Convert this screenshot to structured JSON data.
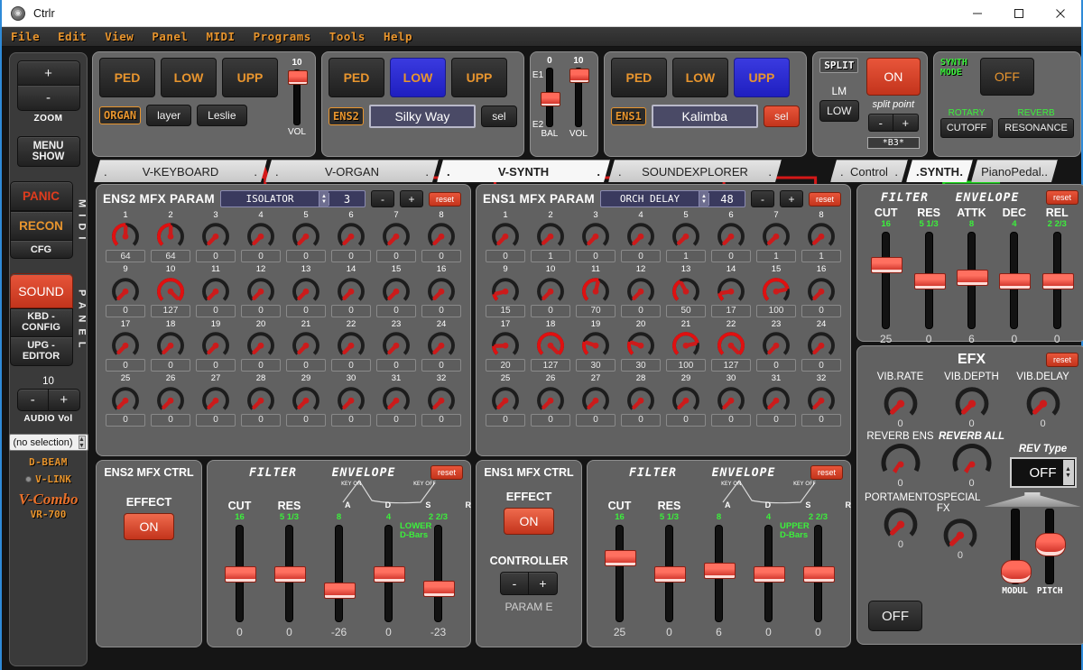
{
  "window": {
    "title": "Ctrlr",
    "minimize": "—",
    "maximize": "□",
    "close": "✕"
  },
  "menubar": {
    "items": [
      "File",
      "Edit",
      "View",
      "Panel",
      "MIDI",
      "Programs",
      "Tools",
      "Help"
    ]
  },
  "sidebar": {
    "zoom_plus": "+",
    "zoom_minus": "-",
    "zoom_label": "ZOOM",
    "menu_show_l1": "MENU",
    "menu_show_l2": "SHOW",
    "panic": "PANIC",
    "recon": "RECON",
    "cfg": "CFG",
    "midi_label": "M I D I",
    "sound": "SOUND",
    "kbd_l1": "KBD -",
    "kbd_l2": "CONFIG",
    "upg_l1": "UPG -",
    "upg_l2": "EDITOR",
    "panel_label": "P A N E L",
    "vol_value": "10",
    "vol_minus": "-",
    "vol_plus": "+",
    "vol_label": "AUDIO Vol",
    "selection": "(no selection)",
    "dbeam": "D-BEAM",
    "vlink": "V-LINK",
    "brand": "V-Combo",
    "brand_model": "VR-700"
  },
  "header": {
    "organ": {
      "parts": [
        {
          "label": "PED",
          "state": "off"
        },
        {
          "label": "LOW",
          "state": "off"
        },
        {
          "label": "UPP",
          "state": "off"
        }
      ],
      "tag": "ORGAN",
      "layer": "layer",
      "leslie": "Leslie",
      "vol_top": "10",
      "vol_label": "VOL"
    },
    "ens2": {
      "parts": [
        {
          "label": "PED",
          "state": "off"
        },
        {
          "label": "LOW",
          "state": "on"
        },
        {
          "label": "UPP",
          "state": "off"
        }
      ],
      "tag": "ENS2",
      "patch": "Silky Way",
      "sel": "sel"
    },
    "bal": {
      "bal_top": "0",
      "vol_top": "10",
      "e1": "E1",
      "e2": "E2",
      "bal_label": "BAL",
      "vol_label": "VOL"
    },
    "ens1": {
      "parts": [
        {
          "label": "PED",
          "state": "off"
        },
        {
          "label": "LOW",
          "state": "off"
        },
        {
          "label": "UPP",
          "state": "on"
        }
      ],
      "tag": "ENS1",
      "patch": "Kalimba",
      "sel": "sel"
    },
    "split": {
      "tag": "SPLIT",
      "on": "ON",
      "lm": "LM",
      "low": "LOW",
      "split_point_label": "split point",
      "minus": "-",
      "plus": "+",
      "note": "*B3*"
    },
    "synthmode": {
      "tag_l1": "SYNTH",
      "tag_l2": "MODE",
      "off": "OFF",
      "rotary_label": "ROTARY",
      "reverb_label": "REVERB",
      "cutoff": "CUTOFF",
      "resonance": "RESONANCE"
    }
  },
  "tabs": {
    "main": [
      {
        "label": "V-KEYBOARD",
        "active": false
      },
      {
        "label": "V-ORGAN",
        "active": false
      },
      {
        "label": "V-SYNTH",
        "active": true
      },
      {
        "label": "SOUNDEXPLORER",
        "active": false
      }
    ],
    "sub": [
      {
        "label": "Control",
        "active": false
      },
      {
        "label": "SYNTH",
        "active": true
      },
      {
        "label": "PianoPedal.",
        "active": false
      }
    ],
    "dot": "."
  },
  "mfx": [
    {
      "title": "ENS2 MFX PARAM",
      "effect_name": "ISOLATOR",
      "effect_num": "3",
      "minus": "-",
      "plus": "+",
      "reset": "reset",
      "knobs": [
        {
          "n": "1",
          "v": "64"
        },
        {
          "n": "2",
          "v": "64"
        },
        {
          "n": "3",
          "v": "0"
        },
        {
          "n": "4",
          "v": "0"
        },
        {
          "n": "5",
          "v": "0"
        },
        {
          "n": "6",
          "v": "0"
        },
        {
          "n": "7",
          "v": "0"
        },
        {
          "n": "8",
          "v": "0"
        },
        {
          "n": "9",
          "v": "0"
        },
        {
          "n": "10",
          "v": "127"
        },
        {
          "n": "11",
          "v": "0"
        },
        {
          "n": "12",
          "v": "0"
        },
        {
          "n": "13",
          "v": "0"
        },
        {
          "n": "14",
          "v": "0"
        },
        {
          "n": "15",
          "v": "0"
        },
        {
          "n": "16",
          "v": "0"
        },
        {
          "n": "17",
          "v": "0"
        },
        {
          "n": "18",
          "v": "0"
        },
        {
          "n": "19",
          "v": "0"
        },
        {
          "n": "20",
          "v": "0"
        },
        {
          "n": "21",
          "v": "0"
        },
        {
          "n": "22",
          "v": "0"
        },
        {
          "n": "23",
          "v": "0"
        },
        {
          "n": "24",
          "v": "0"
        },
        {
          "n": "25",
          "v": "0"
        },
        {
          "n": "26",
          "v": "0"
        },
        {
          "n": "27",
          "v": "0"
        },
        {
          "n": "28",
          "v": "0"
        },
        {
          "n": "29",
          "v": "0"
        },
        {
          "n": "30",
          "v": "0"
        },
        {
          "n": "31",
          "v": "0"
        },
        {
          "n": "32",
          "v": "0"
        }
      ]
    },
    {
      "title": "ENS1 MFX PARAM",
      "effect_name": "ORCH DELAY",
      "effect_num": "48",
      "minus": "-",
      "plus": "+",
      "reset": "reset",
      "knobs": [
        {
          "n": "1",
          "v": "0"
        },
        {
          "n": "2",
          "v": "1"
        },
        {
          "n": "3",
          "v": "0"
        },
        {
          "n": "4",
          "v": "0"
        },
        {
          "n": "5",
          "v": "1"
        },
        {
          "n": "6",
          "v": "0"
        },
        {
          "n": "7",
          "v": "1"
        },
        {
          "n": "8",
          "v": "1"
        },
        {
          "n": "9",
          "v": "15"
        },
        {
          "n": "10",
          "v": "0"
        },
        {
          "n": "11",
          "v": "70"
        },
        {
          "n": "12",
          "v": "0"
        },
        {
          "n": "13",
          "v": "50"
        },
        {
          "n": "14",
          "v": "17"
        },
        {
          "n": "15",
          "v": "100"
        },
        {
          "n": "16",
          "v": "0"
        },
        {
          "n": "17",
          "v": "20"
        },
        {
          "n": "18",
          "v": "127"
        },
        {
          "n": "19",
          "v": "30"
        },
        {
          "n": "20",
          "v": "30"
        },
        {
          "n": "21",
          "v": "100"
        },
        {
          "n": "22",
          "v": "127"
        },
        {
          "n": "23",
          "v": "0"
        },
        {
          "n": "24",
          "v": "0"
        },
        {
          "n": "25",
          "v": "0"
        },
        {
          "n": "26",
          "v": "0"
        },
        {
          "n": "27",
          "v": "0"
        },
        {
          "n": "28",
          "v": "0"
        },
        {
          "n": "29",
          "v": "0"
        },
        {
          "n": "30",
          "v": "0"
        },
        {
          "n": "31",
          "v": "0"
        },
        {
          "n": "32",
          "v": "0"
        }
      ]
    }
  ],
  "ctrl": [
    {
      "title": "ENS2 MFX CTRL",
      "effect_label": "EFFECT",
      "effect_state": "ON",
      "has_controller": false,
      "filter_label": "FILTER",
      "envelope_label": "ENVELOPE",
      "key_on": "KEY ON",
      "key_off": "KEY OFF",
      "adsr": [
        "A",
        "D",
        "S",
        "R"
      ],
      "dbars_l1": "LOWER",
      "dbars_l2": "D-Bars",
      "reset": "reset",
      "sliders": [
        {
          "label": "CUT",
          "sub": "16",
          "value": "0"
        },
        {
          "label": "RES",
          "sub": "5 1/3",
          "value": "0"
        },
        {
          "label": "",
          "sub": "8",
          "value": "-26"
        },
        {
          "label": "",
          "sub": "4",
          "value": "0"
        },
        {
          "label": "",
          "sub": "2 2/3",
          "value": "-23"
        }
      ]
    },
    {
      "title": "ENS1 MFX CTRL",
      "effect_label": "EFFECT",
      "effect_state": "ON",
      "has_controller": true,
      "controller_label": "CONTROLLER",
      "controller_minus": "-",
      "controller_plus": "+",
      "controller_param": "PARAM E",
      "filter_label": "FILTER",
      "envelope_label": "ENVELOPE",
      "key_on": "KEY ON",
      "key_off": "KEY OFF",
      "adsr": [
        "A",
        "D",
        "S",
        "R"
      ],
      "dbars_l1": "UPPER",
      "dbars_l2": "D-Bars",
      "reset": "reset",
      "sliders": [
        {
          "label": "CUT",
          "sub": "16",
          "value": "25"
        },
        {
          "label": "RES",
          "sub": "5 1/3",
          "value": "0"
        },
        {
          "label": "",
          "sub": "8",
          "value": "6"
        },
        {
          "label": "",
          "sub": "4",
          "value": "0"
        },
        {
          "label": "",
          "sub": "2 2/3",
          "value": "0"
        }
      ]
    }
  ],
  "right_filter": {
    "filter_label": "FILTER",
    "envelope_label": "ENVELOPE",
    "reset": "reset",
    "sliders": [
      {
        "label": "CUT",
        "sub": "16",
        "value": "25"
      },
      {
        "label": "RES",
        "sub": "5 1/3",
        "value": "0"
      },
      {
        "label": "ATTK",
        "sub": "8",
        "value": "6"
      },
      {
        "label": "DEC",
        "sub": "4",
        "value": "0"
      },
      {
        "label": "REL",
        "sub": "2 2/3",
        "value": "0"
      }
    ]
  },
  "efx": {
    "title": "EFX",
    "reset": "reset",
    "knobs_row1": [
      {
        "label": "VIB.RATE",
        "value": "0",
        "italic": false
      },
      {
        "label": "VIB.DEPTH",
        "value": "0",
        "italic": false
      },
      {
        "label": "VIB.DELAY",
        "value": "0",
        "italic": false
      }
    ],
    "knobs_row2": [
      {
        "label": "REVERB ENS",
        "value": "0",
        "italic": false
      },
      {
        "label": "REVERB ALL",
        "value": "0",
        "italic": true
      }
    ],
    "rev_type_label": "REV Type",
    "rev_type_value": "OFF",
    "knobs_row3": [
      {
        "label": "PORTAMENTO",
        "value": "0",
        "italic": false
      },
      {
        "label": "SPECIAL FX",
        "value": "0",
        "italic": false
      }
    ],
    "off_button": "OFF",
    "wheel_modul": "MODUL",
    "wheel_pitch": "PITCH"
  },
  "colors": {
    "accent_orange": "#e8952e",
    "accent_red": "#c3341c",
    "accent_green": "#3cf03c",
    "accent_blue": "#2e2ee0",
    "panel_grey": "#666666"
  }
}
